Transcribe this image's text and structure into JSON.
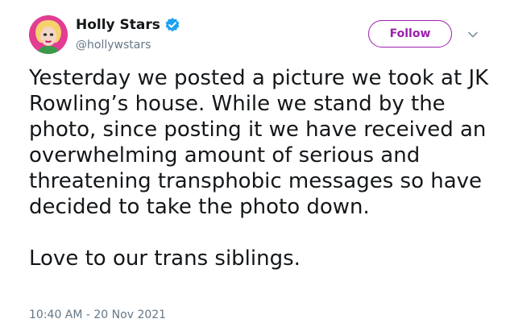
{
  "user": {
    "display_name": "Holly Stars",
    "handle": "@hollywstars",
    "verified": true,
    "avatar_icon": "user-avatar"
  },
  "actions": {
    "follow_label": "Follow",
    "menu_icon": "chevron-down-icon"
  },
  "tweet": {
    "paragraphs": [
      "Yesterday we posted a picture we took at JK Rowling’s house. While we stand by the photo, since posting it we have received an overwhelming amount of serious and threatening transphobic messages so have decided to take the photo down.",
      "Love to our trans siblings."
    ],
    "timestamp": "10:40 AM - 20 Nov 2021"
  },
  "colors": {
    "accent": "#9d1fae",
    "verified": "#1da1f2",
    "text": "#14171a",
    "muted": "#657786"
  }
}
